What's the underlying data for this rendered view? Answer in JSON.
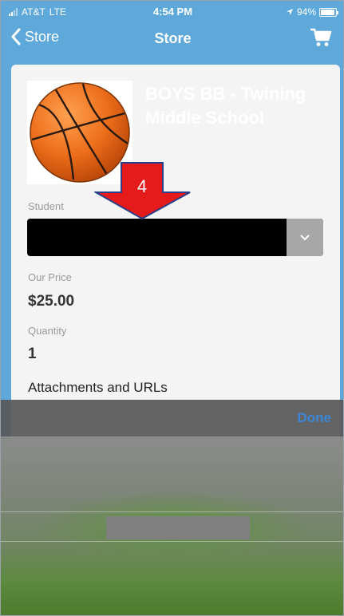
{
  "status_bar": {
    "carrier": "AT&T",
    "network": "LTE",
    "time": "4:54 PM",
    "battery": "94%",
    "battery_level": 0.94
  },
  "nav": {
    "back_label": "Store",
    "title": "Store",
    "cart_icon": "cart-icon"
  },
  "product": {
    "title": "BOYS BB - Twining Middle School",
    "image_icon": "basketball-icon"
  },
  "form": {
    "student_label": "Student",
    "price_label": "Our Price",
    "price_value": "$25.00",
    "quantity_label": "Quantity",
    "quantity_value": "1",
    "attachments_heading": "Attachments and URLs"
  },
  "annotation": {
    "step_number": "4",
    "color": "#e51b1b"
  },
  "picker": {
    "done_label": "Done"
  },
  "colors": {
    "nav_background": "#5ea9da",
    "done_blue": "#3b86d8"
  }
}
